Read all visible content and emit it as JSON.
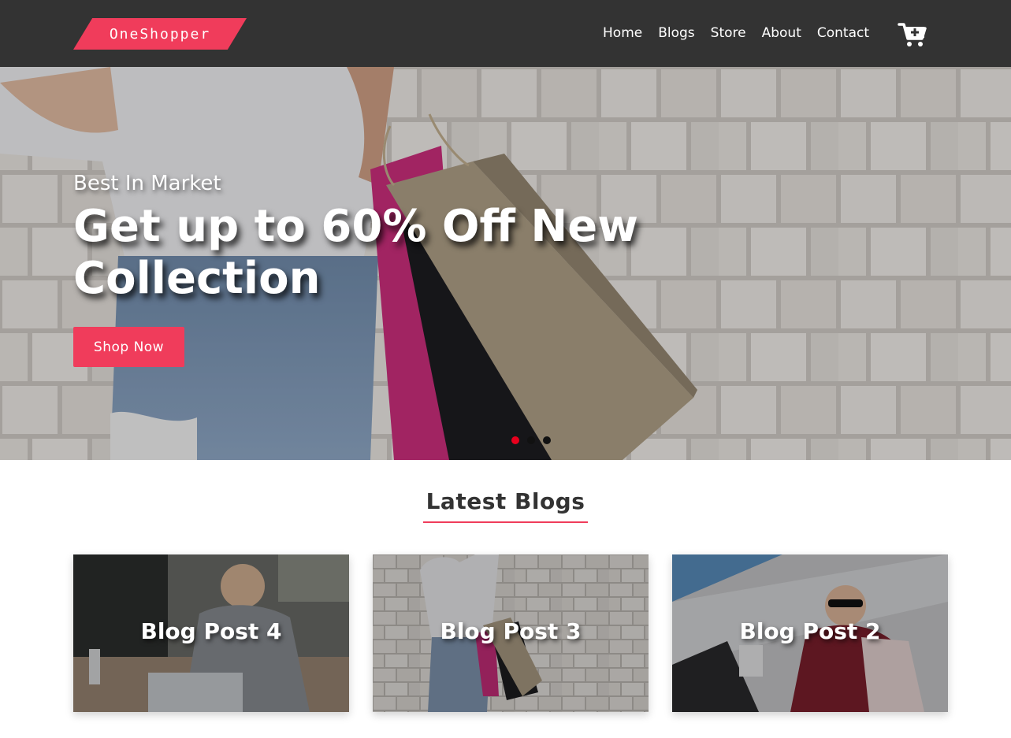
{
  "brand": {
    "name": "OneShopper",
    "accent": "#f03c5b",
    "navbar_bg": "#333333"
  },
  "nav": {
    "links": [
      "Home",
      "Blogs",
      "Store",
      "About",
      "Contact"
    ],
    "cart_icon": "shopping-cart-plus-icon"
  },
  "hero": {
    "kicker": "Best In Market",
    "title": "Get up to 60% Off New Collection",
    "button": "Shop Now",
    "slides": 3,
    "active_slide": 1,
    "active_dot_color": "#e8001d"
  },
  "blogs": {
    "heading": "Latest Blogs",
    "posts": [
      {
        "title": "Blog Post 4"
      },
      {
        "title": "Blog Post 3"
      },
      {
        "title": "Blog Post 2"
      }
    ]
  }
}
